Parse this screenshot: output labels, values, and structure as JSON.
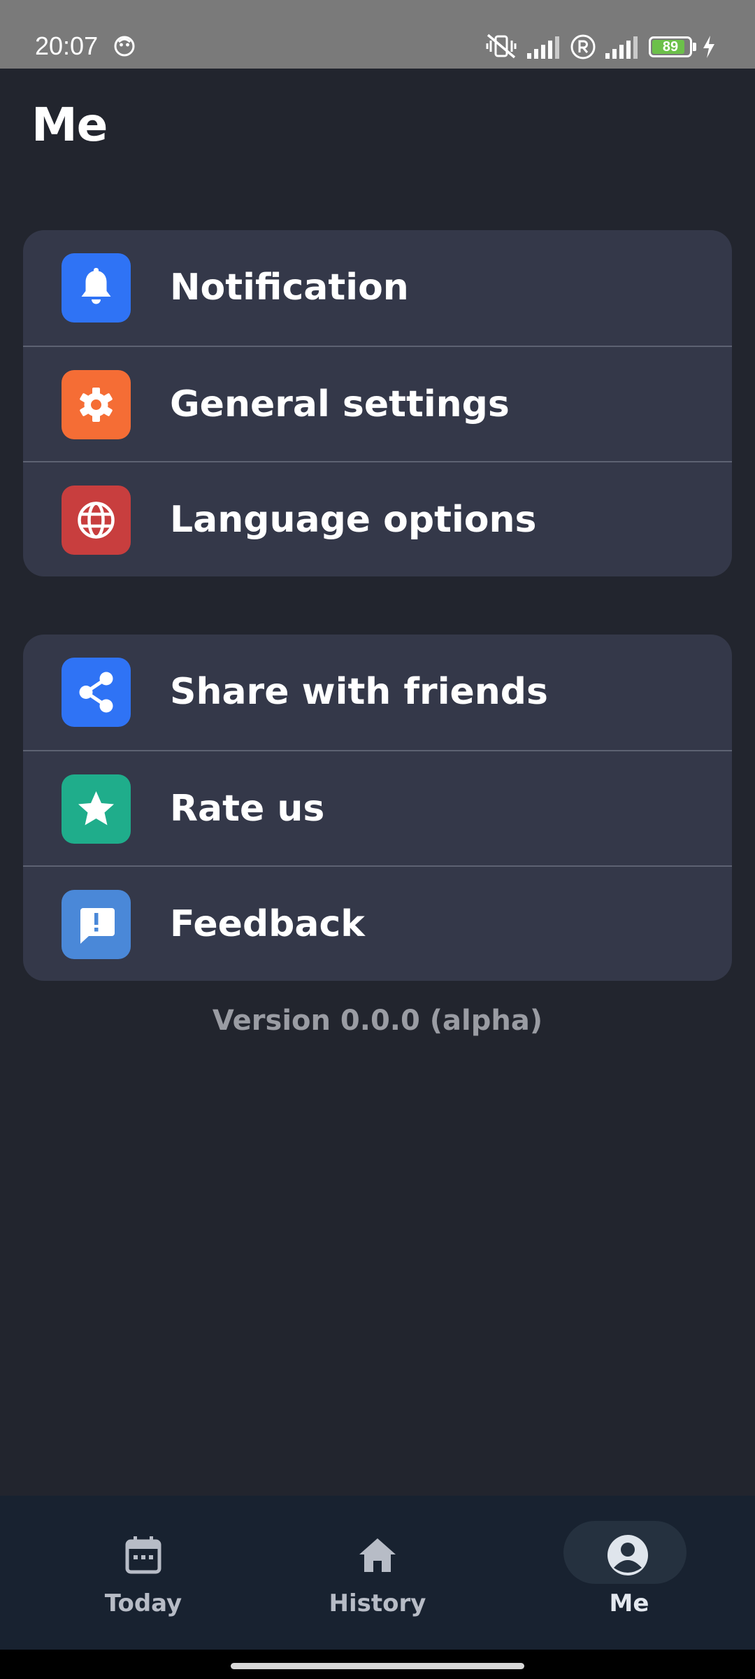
{
  "status_bar": {
    "time": "20:07",
    "battery_level": "89",
    "battery_fraction": 0.89,
    "icons": [
      "face-app-icon",
      "vibrate-off-icon",
      "signal-icon",
      "registered-icon",
      "signal-icon",
      "battery-icon",
      "charging-icon"
    ]
  },
  "header": {
    "title": "Me"
  },
  "settings_group": [
    {
      "label": "Notification",
      "icon": "bell-icon",
      "color": "#2f73f5"
    },
    {
      "label": "General settings",
      "icon": "gear-icon",
      "color": "#f56d35"
    },
    {
      "label": "Language options",
      "icon": "globe-icon",
      "color": "#c83e3e"
    }
  ],
  "social_group": [
    {
      "label": "Share with friends",
      "icon": "share-icon",
      "color": "#2f73f5"
    },
    {
      "label": "Rate us",
      "icon": "star-icon",
      "color": "#1fad8b"
    },
    {
      "label": "Feedback",
      "icon": "feedback-icon",
      "color": "#4a88d8"
    }
  ],
  "version": "Version 0.0.0 (alpha)",
  "bottom_nav": {
    "active": "Me",
    "items": [
      {
        "label": "Today",
        "icon": "calendar-icon"
      },
      {
        "label": "History",
        "icon": "home-icon"
      },
      {
        "label": "Me",
        "icon": "account-icon"
      }
    ]
  },
  "colors": {
    "background": "#22252e",
    "card": "#343849",
    "nav_background": "#182230",
    "battery_fill": "#6cc04a"
  }
}
